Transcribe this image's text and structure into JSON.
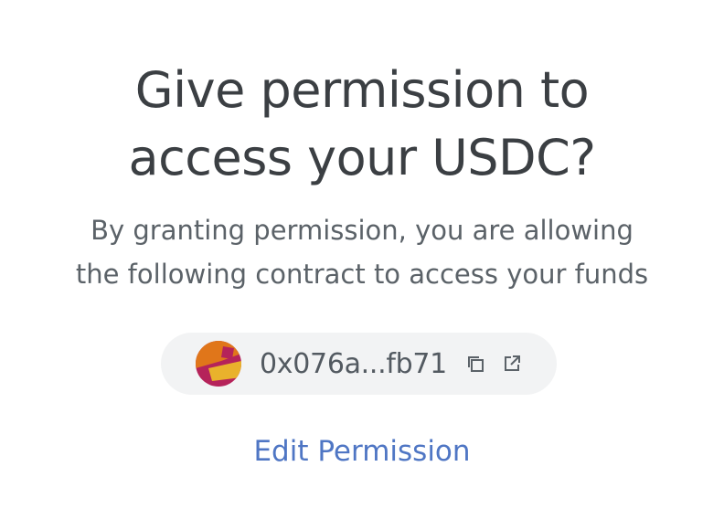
{
  "header": {
    "title_line1": "Give permission to",
    "title_line2": "access your USDC?"
  },
  "description": {
    "line1": "By granting permission, you are allowing",
    "line2": "the following contract to access your funds"
  },
  "contract": {
    "address_short": "0x076a...fb71",
    "avatar_colors": [
      "#e0761a",
      "#b5235a",
      "#e9b22c"
    ],
    "icons": {
      "copy": "copy-icon",
      "open": "external-link-icon"
    }
  },
  "actions": {
    "edit_permission_label": "Edit Permission"
  },
  "colors": {
    "title": "#3b3f43",
    "subtitle": "#5b6268",
    "pill_bg": "#f2f3f4",
    "link": "#4f76c4"
  }
}
